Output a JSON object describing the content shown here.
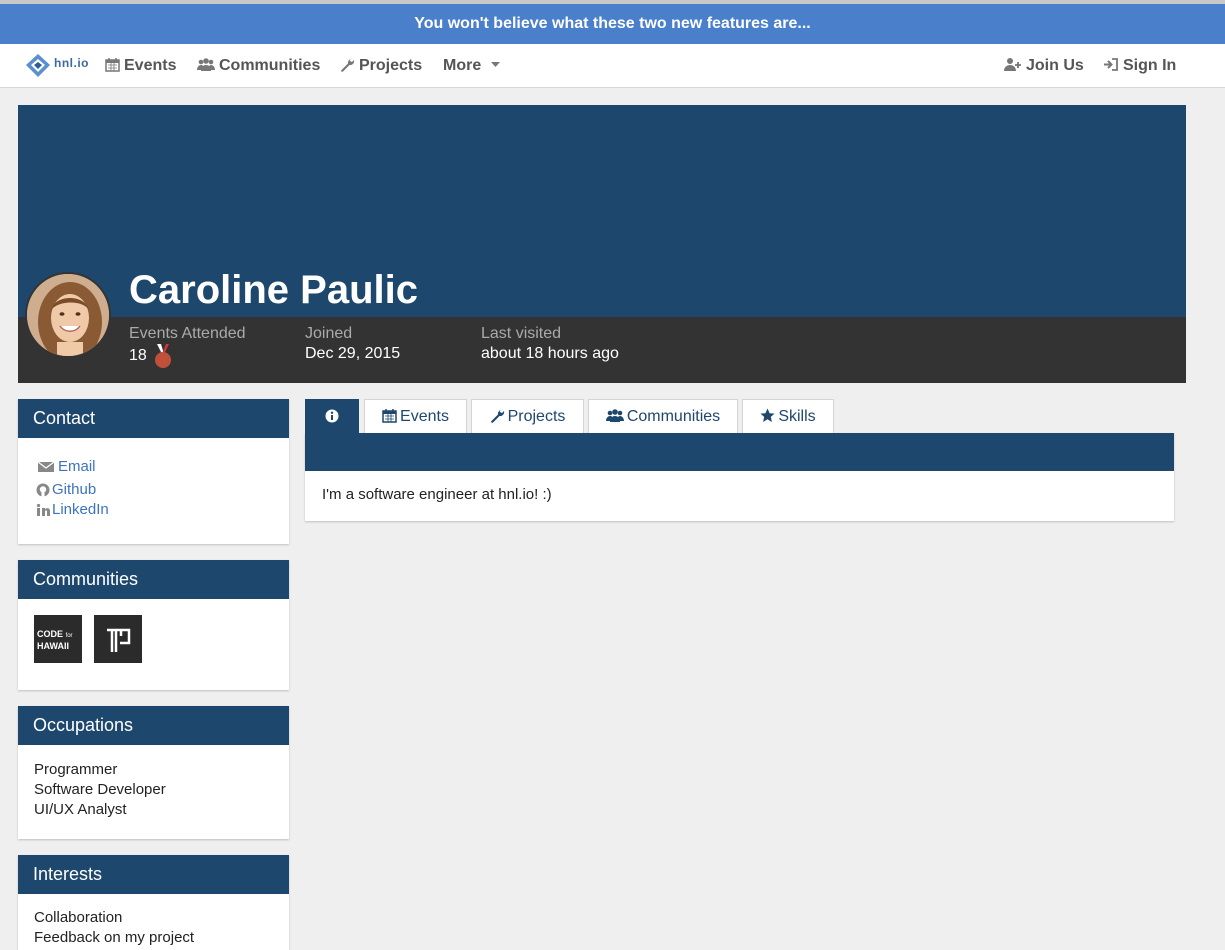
{
  "banner": {
    "text": "You won't believe what these two new features are..."
  },
  "nav": {
    "logo_text": "hnl.io",
    "items": [
      {
        "label": "Events",
        "icon": "calendar-icon"
      },
      {
        "label": "Communities",
        "icon": "users-icon"
      },
      {
        "label": "Projects",
        "icon": "wrench-icon"
      },
      {
        "label": "More",
        "icon": "caret-down-icon"
      }
    ],
    "join_label": "Join Us",
    "signin_label": "Sign In"
  },
  "profile": {
    "name": "Caroline Paulic",
    "stats": [
      {
        "label": "Events Attended",
        "value": "18"
      },
      {
        "label": "Joined",
        "value": "Dec 29, 2015"
      },
      {
        "label": "Last visited",
        "value": "about 18 hours ago"
      }
    ]
  },
  "contact": {
    "title": "Contact",
    "links": [
      {
        "label": "Email",
        "icon": "envelope-icon"
      },
      {
        "label": "Github",
        "icon": "github-icon"
      },
      {
        "label": "LinkedIn",
        "icon": "linkedin-icon"
      }
    ]
  },
  "communities": {
    "title": "Communities",
    "logos": [
      {
        "line1": "CODE",
        "small": "for",
        "line2": "HAWAII"
      },
      {
        "name": "pillar-logo"
      }
    ]
  },
  "occupations": {
    "title": "Occupations",
    "items": [
      "Programmer",
      "Software Developer",
      "UI/UX Analyst"
    ]
  },
  "interests": {
    "title": "Interests",
    "items": [
      "Collaboration",
      "Feedback on my project"
    ]
  },
  "tabs": [
    {
      "label": "",
      "icon": "info-icon"
    },
    {
      "label": "Events",
      "icon": "calendar-icon"
    },
    {
      "label": "Projects",
      "icon": "wrench-icon"
    },
    {
      "label": "Communities",
      "icon": "users-icon"
    },
    {
      "label": "Skills",
      "icon": "star-icon"
    }
  ],
  "about": {
    "text": "I'm a software engineer at hnl.io! :)"
  },
  "colors": {
    "navy": "#1d476d",
    "banner": "#4a7fcb",
    "link": "#3d74c0",
    "stat_bar": "#333333"
  }
}
